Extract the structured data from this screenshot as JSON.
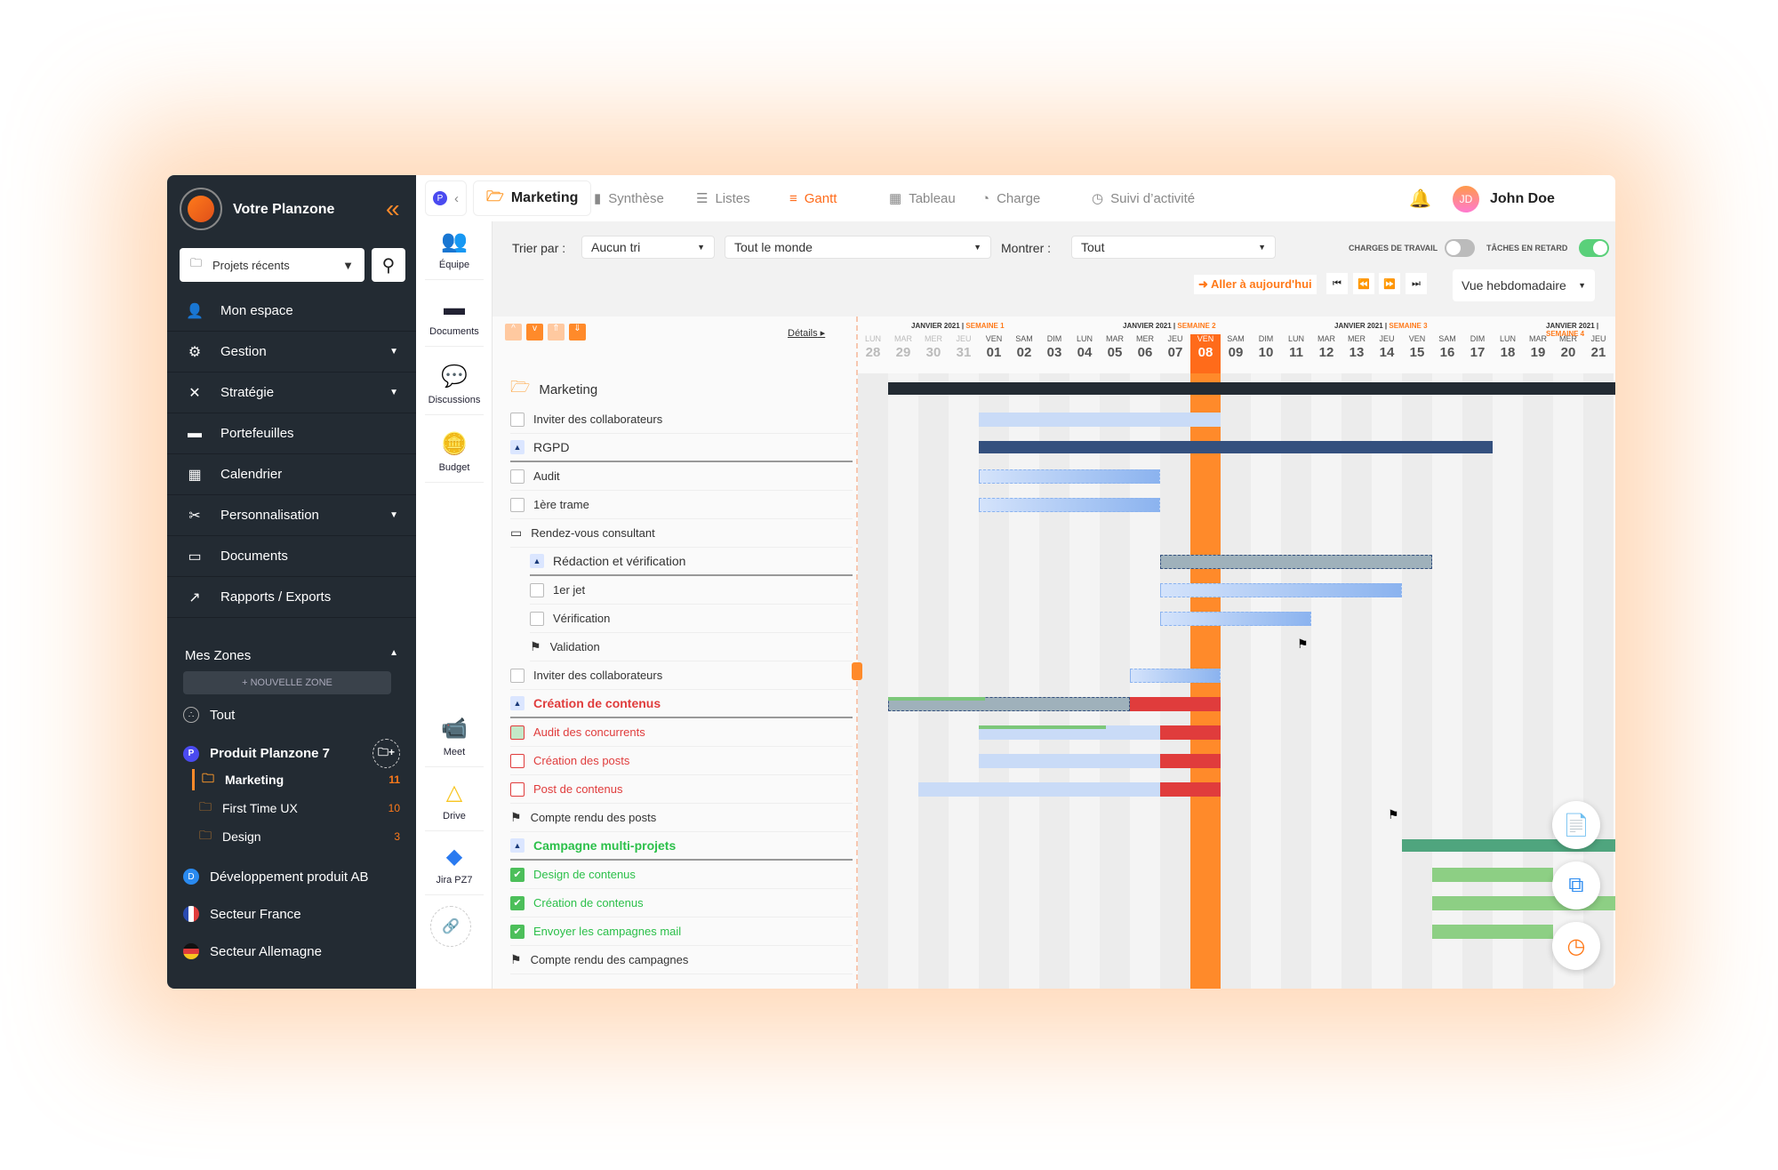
{
  "brand": "Votre Planzone",
  "recent": "Projets récents",
  "nav": [
    {
      "label": "Mon espace",
      "icon": "user-lock-icon",
      "g": "👤"
    },
    {
      "label": "Gestion",
      "icon": "users-gear-icon",
      "g": "⚙",
      "caret": true
    },
    {
      "label": "Stratégie",
      "icon": "strategy-icon",
      "g": "✕",
      "caret": true
    },
    {
      "label": "Portefeuilles",
      "icon": "wallet-icon",
      "g": "▬"
    },
    {
      "label": "Calendrier",
      "icon": "calendar-icon",
      "g": "▦"
    },
    {
      "label": "Personnalisation",
      "icon": "tools-icon",
      "g": "✂",
      "caret": true
    },
    {
      "label": "Documents",
      "icon": "document-icon",
      "g": "▭"
    },
    {
      "label": "Rapports / Exports",
      "icon": "export-icon",
      "g": "↗"
    }
  ],
  "zones": {
    "title": "Mes Zones",
    "new": "+ NOUVELLE ZONE",
    "all": "Tout",
    "items": [
      {
        "label": "Produit Planzone 7",
        "badge": "P",
        "color": "#4a4af0",
        "bold": true
      },
      {
        "label": "Marketing",
        "count": "11",
        "sub": true,
        "active": true
      },
      {
        "label": "First Time UX",
        "count": "10",
        "sub": true
      },
      {
        "label": "Design",
        "count": "3",
        "sub": true
      },
      {
        "label": "Développement produit AB",
        "badge": "D",
        "color": "#2a8af0"
      },
      {
        "label": "Secteur France",
        "flag": "fr"
      },
      {
        "label": "Secteur Allemagne",
        "flag": "de"
      }
    ]
  },
  "apps": [
    {
      "label": "Équipe",
      "g": "👥",
      "icon": "team-icon"
    },
    {
      "label": "Documents",
      "g": "▬",
      "icon": "documents-icon"
    },
    {
      "label": "Discussions",
      "g": "💬",
      "icon": "discussions-icon"
    },
    {
      "label": "Budget",
      "g": "🪙",
      "icon": "budget-icon"
    }
  ],
  "integrations": [
    {
      "label": "Meet",
      "g": "📹",
      "icon": "meet-icon"
    },
    {
      "label": "Drive",
      "g": "△",
      "icon": "drive-icon"
    },
    {
      "label": "Jira PZ7",
      "g": "◆",
      "icon": "jira-icon"
    }
  ],
  "tabs": {
    "project": "Marketing",
    "items": [
      {
        "label": "Synthèse",
        "g": "▮",
        "icon": "synthese-icon"
      },
      {
        "label": "Listes",
        "g": "☰",
        "icon": "list-icon"
      },
      {
        "label": "Gantt",
        "g": "≡",
        "icon": "gantt-icon",
        "active": true
      },
      {
        "label": "Tableau",
        "g": "▦",
        "icon": "board-icon"
      },
      {
        "label": "Charge",
        "g": "◔",
        "icon": "gauge-icon"
      },
      {
        "label": "Suivi d’activité",
        "g": "◷",
        "icon": "clock-icon"
      }
    ]
  },
  "user": {
    "initials": "JD",
    "name": "John Doe"
  },
  "toolbar": {
    "sort_label": "Trier par :",
    "sort": "Aucun tri",
    "people": "Tout le monde",
    "show_label": "Montrer :",
    "show": "Tout",
    "workload": "CHARGES DE TRAVAIL",
    "workload_on": false,
    "late": "TÂCHES EN RETARD",
    "late_on": true,
    "today": "Aller à aujourd'hui",
    "view": "Vue hebdomadaire",
    "details": "Détails"
  },
  "calendar": {
    "today": "2021-01-08",
    "weeks": [
      {
        "month": "JANVIER 2021",
        "week": "SEMAINE 1"
      },
      {
        "month": "JANVIER 2021",
        "week": "SEMAINE 2"
      },
      {
        "month": "JANVIER 2021",
        "week": "SEMAINE 3"
      },
      {
        "month": "JANVIER 2021",
        "week": "SEMAINE 4"
      }
    ],
    "days": [
      [
        "LUN",
        "28"
      ],
      [
        "MAR",
        "29"
      ],
      [
        "MER",
        "30"
      ],
      [
        "JEU",
        "31"
      ],
      [
        "VEN",
        "01"
      ],
      [
        "SAM",
        "02"
      ],
      [
        "DIM",
        "03"
      ],
      [
        "LUN",
        "04"
      ],
      [
        "MAR",
        "05"
      ],
      [
        "MER",
        "06"
      ],
      [
        "JEU",
        "07"
      ],
      [
        "VEN",
        "08"
      ],
      [
        "SAM",
        "09"
      ],
      [
        "DIM",
        "10"
      ],
      [
        "LUN",
        "11"
      ],
      [
        "MAR",
        "12"
      ],
      [
        "MER",
        "13"
      ],
      [
        "JEU",
        "14"
      ],
      [
        "VEN",
        "15"
      ],
      [
        "SAM",
        "16"
      ],
      [
        "DIM",
        "17"
      ],
      [
        "LUN",
        "18"
      ],
      [
        "MAR",
        "19"
      ],
      [
        "MER",
        "20"
      ],
      [
        "JEU",
        "21"
      ]
    ]
  },
  "colors": {
    "accent": "#ff7a1a",
    "late": "#e03c3c",
    "done": "#2cc04a",
    "dark": "#232b33"
  },
  "tasks": [
    {
      "label": "Marketing",
      "type": "project",
      "bar": {
        "kind": "summary-dark",
        "start": "2020-12-29",
        "end": "2021-01-22"
      }
    },
    {
      "label": "Inviter des collaborateurs",
      "type": "task",
      "bar": {
        "kind": "task",
        "start": "2021-01-01",
        "end": "2021-01-08"
      }
    },
    {
      "label": "RGPD",
      "type": "group",
      "bar": {
        "kind": "summary-blue",
        "start": "2021-01-01",
        "end": "2021-01-17"
      }
    },
    {
      "label": "Audit",
      "type": "task",
      "indent": 1,
      "bar": {
        "kind": "task-dashed",
        "start": "2021-01-01",
        "end": "2021-01-06"
      }
    },
    {
      "label": "1ère trame",
      "type": "task",
      "indent": 1,
      "bar": {
        "kind": "task-dashed",
        "start": "2021-01-01",
        "end": "2021-01-06"
      }
    },
    {
      "label": "Rendez-vous consultant",
      "type": "meeting",
      "indent": 1
    },
    {
      "label": "Rédaction et vérification",
      "type": "group",
      "indent": 2,
      "bar": {
        "kind": "summary-gray",
        "start": "2021-01-07",
        "end": "2021-01-15"
      }
    },
    {
      "label": "1er jet",
      "type": "task",
      "indent": 2,
      "bar": {
        "kind": "task-dashed",
        "start": "2021-01-07",
        "end": "2021-01-14"
      }
    },
    {
      "label": "Vérification",
      "type": "task",
      "indent": 2,
      "bar": {
        "kind": "task-dashed",
        "start": "2021-01-07",
        "end": "2021-01-11"
      }
    },
    {
      "label": "Validation",
      "type": "milestone",
      "indent": 2,
      "bar": {
        "kind": "milestone",
        "start": "2021-01-11"
      }
    },
    {
      "label": "Inviter des collaborateurs",
      "type": "task",
      "bar": {
        "kind": "task-dashed",
        "start": "2021-01-06",
        "end": "2021-01-08"
      }
    },
    {
      "label": "Création de contenus",
      "type": "group",
      "status": "late",
      "bar": {
        "kind": "summary-gray",
        "start": "2020-12-29",
        "end": "2021-01-05",
        "late_end": "2021-01-08",
        "progress": 40
      }
    },
    {
      "label": "Audit des concurrents",
      "type": "task",
      "status": "late",
      "indent": 1,
      "partial": true,
      "bar": {
        "kind": "task",
        "start": "2021-01-01",
        "end": "2021-01-06",
        "late_end": "2021-01-08",
        "progress": 70
      }
    },
    {
      "label": "Création des posts",
      "type": "task",
      "status": "late",
      "indent": 1,
      "bar": {
        "kind": "task",
        "start": "2021-01-01",
        "end": "2021-01-06",
        "late_end": "2021-01-08"
      }
    },
    {
      "label": "Post de contenus",
      "type": "task",
      "status": "late",
      "indent": 1,
      "bar": {
        "kind": "task",
        "start": "2020-12-30",
        "end": "2021-01-06",
        "late_end": "2021-01-08"
      }
    },
    {
      "label": "Compte rendu des posts",
      "type": "milestone",
      "indent": 1,
      "bar": {
        "kind": "milestone",
        "start": "2021-01-14"
      }
    },
    {
      "label": "Campagne multi-projets",
      "type": "group",
      "status": "done",
      "bar": {
        "kind": "summary-teal",
        "start": "2021-01-15",
        "end": "2021-01-22"
      }
    },
    {
      "label": "Design de contenus",
      "type": "task",
      "status": "done",
      "indent": 1,
      "bar": {
        "kind": "task-green",
        "start": "2021-01-16",
        "end": "2021-01-19"
      }
    },
    {
      "label": "Création de contenus",
      "type": "task",
      "status": "done",
      "indent": 1,
      "bar": {
        "kind": "task-green",
        "start": "2021-01-16",
        "end": "2021-01-22"
      }
    },
    {
      "label": "Envoyer les campagnes mail",
      "type": "task",
      "status": "done",
      "indent": 1,
      "bar": {
        "kind": "task-green",
        "start": "2021-01-16",
        "end": "2021-01-19"
      }
    },
    {
      "label": "Compte rendu des campagnes",
      "type": "milestone",
      "indent": 1
    }
  ],
  "fabs": [
    {
      "icon": "add-document-icon",
      "g": "📄"
    },
    {
      "icon": "copy-icon",
      "g": "⧉"
    },
    {
      "icon": "timer-icon",
      "g": "◷"
    }
  ]
}
